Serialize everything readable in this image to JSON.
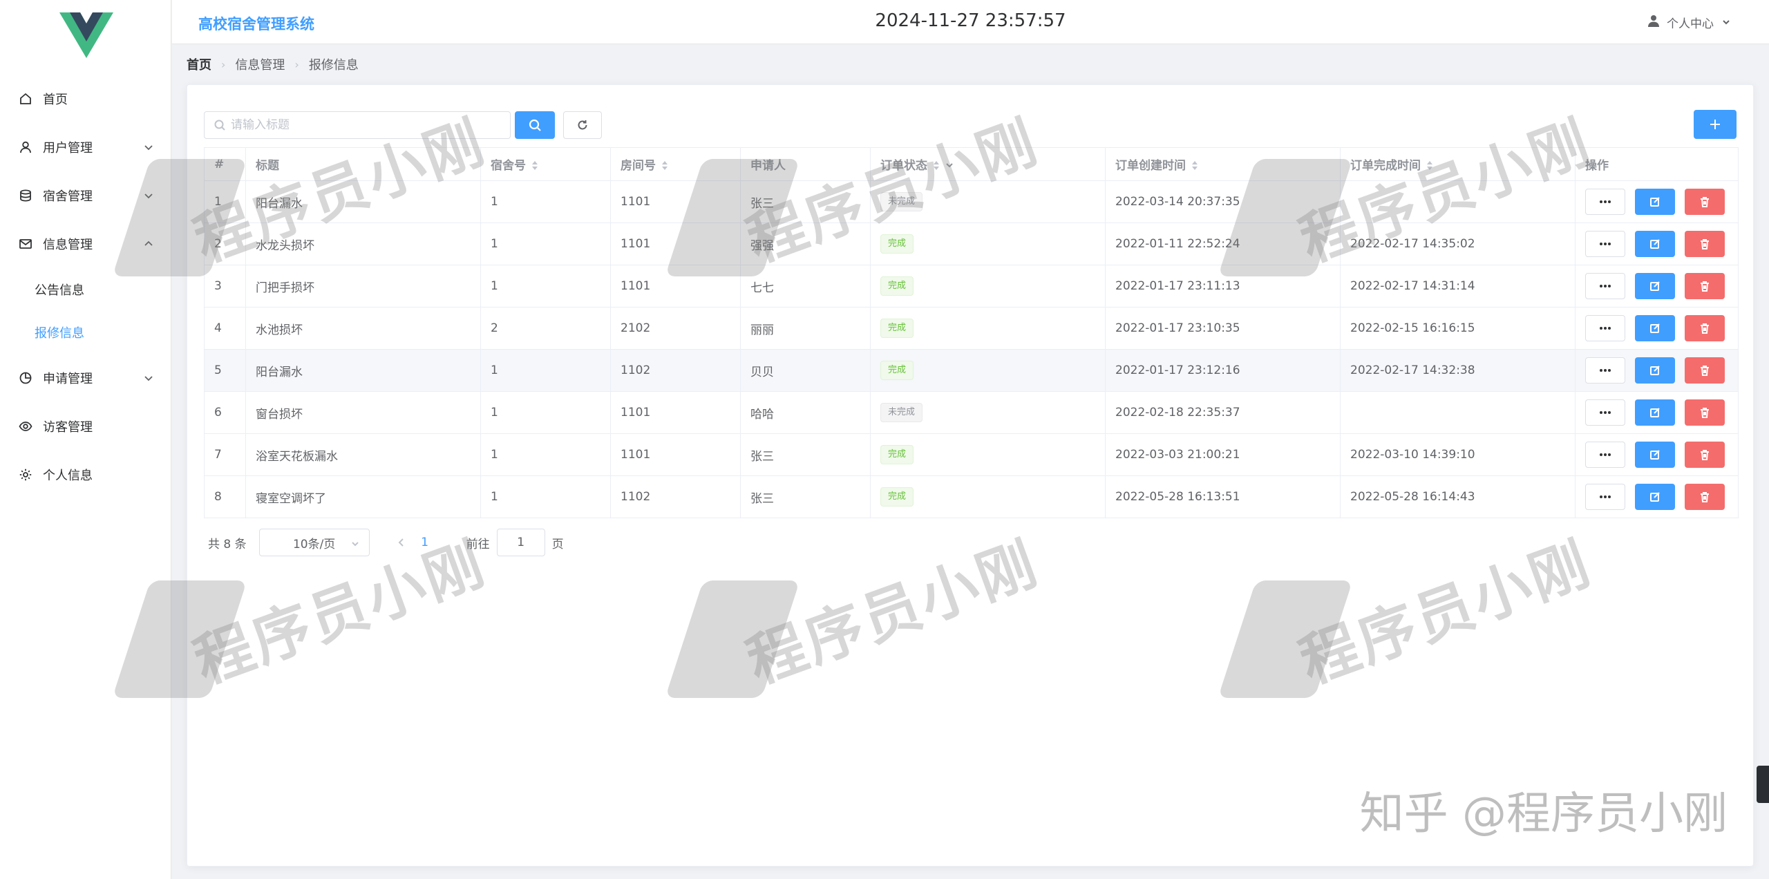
{
  "app": {
    "title": "高校宿舍管理系统",
    "datetime": "2024-11-27 23:57:57",
    "user_center": "个人中心"
  },
  "sidebar": {
    "items": [
      {
        "label": "首页",
        "icon": "home-icon",
        "expandable": false
      },
      {
        "label": "用户管理",
        "icon": "user-icon",
        "expandable": true
      },
      {
        "label": "宿舍管理",
        "icon": "database-icon",
        "expandable": true
      },
      {
        "label": "信息管理",
        "icon": "message-icon",
        "expandable": true,
        "expanded": true,
        "children": [
          {
            "label": "公告信息",
            "active": false
          },
          {
            "label": "报修信息",
            "active": true
          }
        ]
      },
      {
        "label": "申请管理",
        "icon": "pie-chart-icon",
        "expandable": true
      },
      {
        "label": "访客管理",
        "icon": "eye-icon",
        "expandable": false
      },
      {
        "label": "个人信息",
        "icon": "gear-icon",
        "expandable": false
      }
    ]
  },
  "breadcrumb": [
    "首页",
    "信息管理",
    "报修信息"
  ],
  "search": {
    "placeholder": "请输入标题",
    "value": ""
  },
  "table": {
    "columns": [
      "#",
      "标题",
      "宿舍号",
      "房间号",
      "申请人",
      "订单状态",
      "订单创建时间",
      "订单完成时间",
      "操作"
    ],
    "rows": [
      {
        "index": "1",
        "title": "阳台漏水",
        "dorm": "1",
        "room": "1101",
        "applicant": "张三",
        "status": "未完成",
        "created": "2022-03-14 20:37:35",
        "finished": ""
      },
      {
        "index": "2",
        "title": "水龙头损坏",
        "dorm": "1",
        "room": "1101",
        "applicant": "强强",
        "status": "完成",
        "created": "2022-01-11 22:52:24",
        "finished": "2022-02-17 14:35:02"
      },
      {
        "index": "3",
        "title": "门把手损坏",
        "dorm": "1",
        "room": "1101",
        "applicant": "七七",
        "status": "完成",
        "created": "2022-01-17 23:11:13",
        "finished": "2022-02-17 14:31:14"
      },
      {
        "index": "4",
        "title": "水池损坏",
        "dorm": "2",
        "room": "2102",
        "applicant": "丽丽",
        "status": "完成",
        "created": "2022-01-17 23:10:35",
        "finished": "2022-02-15 16:16:15"
      },
      {
        "index": "5",
        "title": "阳台漏水",
        "dorm": "1",
        "room": "1102",
        "applicant": "贝贝",
        "status": "完成",
        "created": "2022-01-17 23:12:16",
        "finished": "2022-02-17 14:32:38"
      },
      {
        "index": "6",
        "title": "窗台损坏",
        "dorm": "1",
        "room": "1101",
        "applicant": "哈哈",
        "status": "未完成",
        "created": "2022-02-18 22:35:37",
        "finished": ""
      },
      {
        "index": "7",
        "title": "浴室天花板漏水",
        "dorm": "1",
        "room": "1101",
        "applicant": "张三",
        "status": "完成",
        "created": "2022-03-03 21:00:21",
        "finished": "2022-03-10 14:39:10"
      },
      {
        "index": "8",
        "title": "寝室空调坏了",
        "dorm": "1",
        "room": "1102",
        "applicant": "张三",
        "status": "完成",
        "created": "2022-05-28 16:13:51",
        "finished": "2022-05-28 16:14:43"
      }
    ]
  },
  "pagination": {
    "total": "共 8 条",
    "page_size": "10条/页",
    "current_page": "1",
    "goto_label": "前往",
    "goto_value": "1",
    "page_suffix": "页"
  },
  "watermark": {
    "text": "程序员小刚",
    "footer": "知乎 @程序员小刚"
  },
  "colors": {
    "primary": "#409eff",
    "danger": "#f56c6c",
    "success": "#67c23a",
    "info": "#909399"
  }
}
